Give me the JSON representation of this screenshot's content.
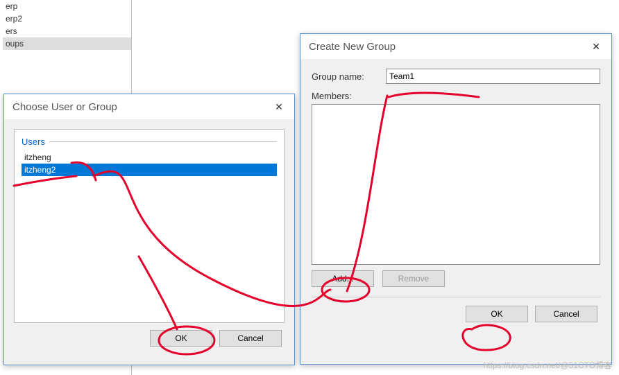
{
  "bg_tree": {
    "items": [
      {
        "label": "erp"
      },
      {
        "label": "erp2"
      },
      {
        "label": "ers"
      },
      {
        "label": "oups",
        "selected": true
      }
    ]
  },
  "choose_dialog": {
    "title": "Choose User or Group",
    "close_icon": "✕",
    "group_header": "Users",
    "users": [
      {
        "name": "itzheng",
        "selected": false
      },
      {
        "name": "itzheng2",
        "selected": true
      }
    ],
    "ok_label": "OK",
    "cancel_label": "Cancel"
  },
  "group_dialog": {
    "title": "Create New Group",
    "close_icon": "✕",
    "group_name_label": "Group name:",
    "group_name_value": "Team1",
    "members_label": "Members:",
    "add_label": "Add...",
    "remove_label": "Remove",
    "ok_label": "OK",
    "cancel_label": "Cancel"
  },
  "watermark": "https://blog.csdn.net/@51CTO博客"
}
